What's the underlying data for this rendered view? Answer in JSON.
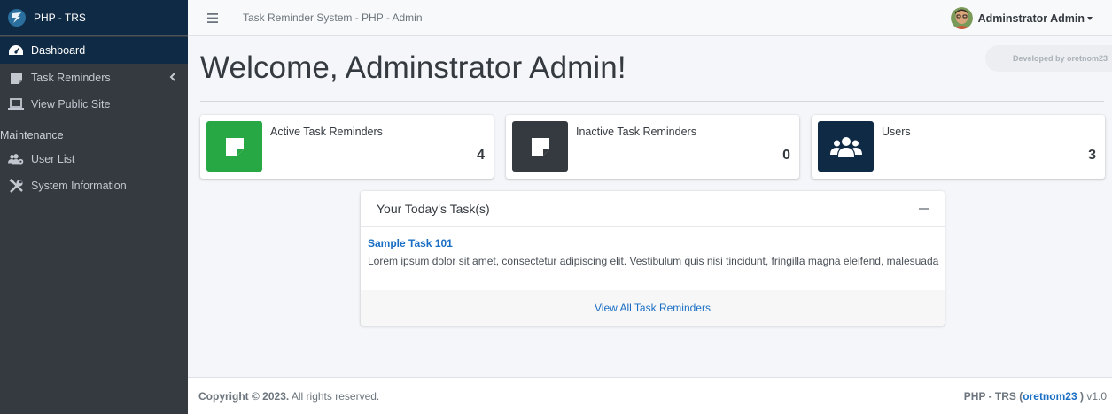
{
  "brand": {
    "name": "PHP - TRS"
  },
  "sidebar": {
    "items": [
      {
        "label": "Dashboard",
        "icon": "tachometer-icon",
        "active": true
      },
      {
        "label": "Task Reminders",
        "icon": "sticky-note-icon",
        "has_submenu": true
      },
      {
        "label": "View Public Site",
        "icon": "laptop-icon"
      }
    ],
    "section_header": "Maintenance",
    "maintenance_items": [
      {
        "label": "User List",
        "icon": "users-cog-icon"
      },
      {
        "label": "System Information",
        "icon": "tools-icon"
      }
    ]
  },
  "topbar": {
    "title": "Task Reminder System - PHP - Admin",
    "user_name": "Adminstrator Admin"
  },
  "main": {
    "developed_by": "Developed by oretnom23",
    "welcome": "Welcome, Adminstrator Admin!",
    "info_boxes": [
      {
        "label": "Active Task Reminders",
        "value": "4",
        "icon": "sticky-note-icon",
        "color": "#28a745"
      },
      {
        "label": "Inactive Task Reminders",
        "value": "0",
        "icon": "sticky-note-icon",
        "color": "#343a40"
      },
      {
        "label": "Users",
        "value": "3",
        "icon": "users-icon",
        "color": "#0f2a44"
      }
    ],
    "tasks_card": {
      "title": "Your Today's Task(s)",
      "task_title": "Sample Task 101",
      "task_desc": "Lorem ipsum dolor sit amet, consectetur adipiscing elit. Vestibulum quis nisi tincidunt, fringilla magna eleifend, malesuada",
      "footer_link": "View All Task Reminders"
    }
  },
  "footer": {
    "copyright": "Copyright © 2023.",
    "rights": "All rights reserved.",
    "app": "PHP - TRS",
    "author": "oretnom23",
    "version": "v1.0"
  },
  "colors": {
    "sidebar_bg": "#343a40",
    "brand_bg": "#0f2a44",
    "link": "#1a6fc4",
    "success": "#28a745"
  }
}
